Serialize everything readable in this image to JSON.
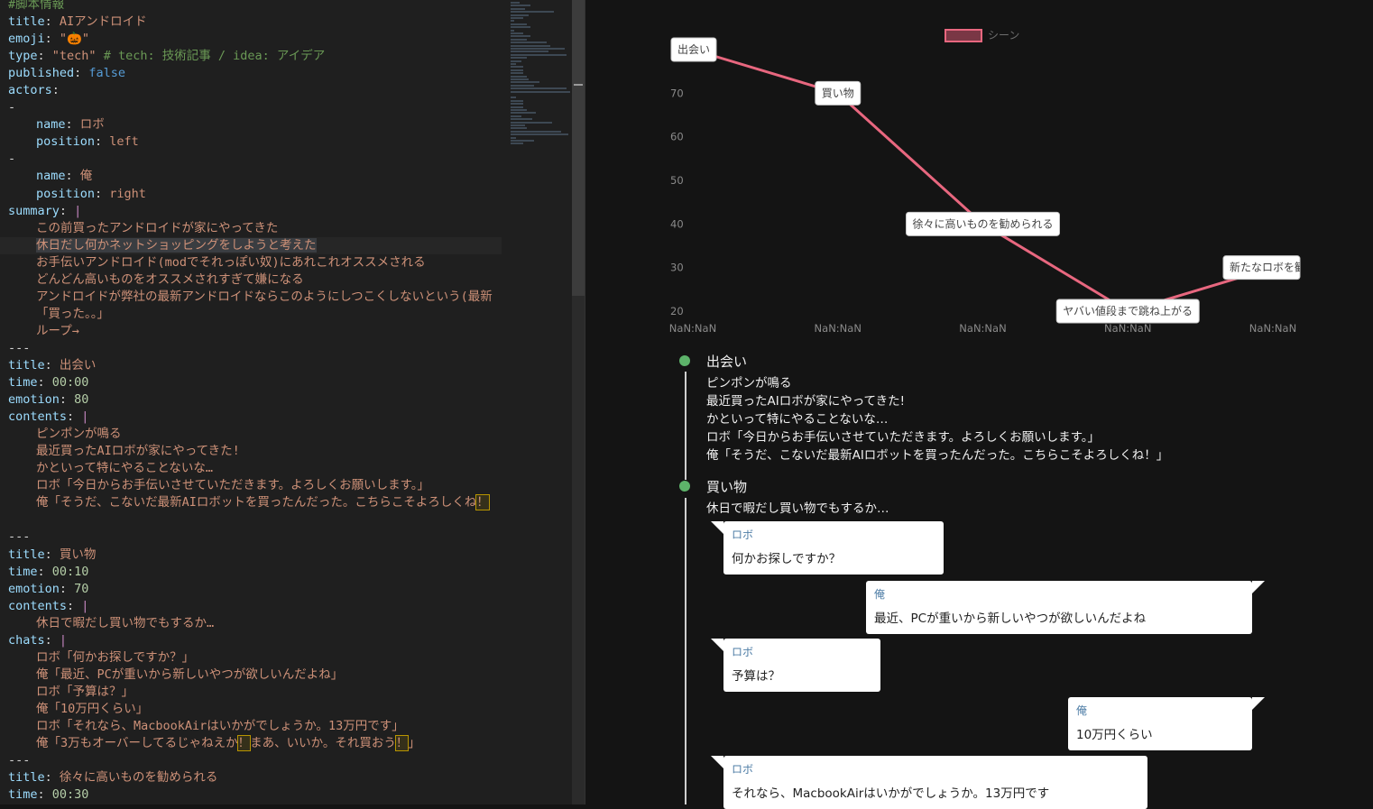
{
  "editor": {
    "lines": [
      {
        "t": "comment",
        "text": "#脚本情報"
      },
      {
        "t": "kv",
        "key": "title",
        "val": "AIアンドロイド",
        "vt": "s"
      },
      {
        "t": "kv",
        "key": "emoji",
        "val": "\"🎃\"",
        "vt": "s"
      },
      {
        "t": "kvc",
        "key": "type",
        "val": "\"tech\"",
        "vt": "s",
        "comment": "# tech: 技術記事 / idea: アイデア"
      },
      {
        "t": "kv",
        "key": "published",
        "val": "false",
        "vt": "b"
      },
      {
        "t": "kv",
        "key": "actors",
        "val": "",
        "vt": "s"
      },
      {
        "t": "dash",
        "text": "-"
      },
      {
        "t": "kv",
        "ind": 1,
        "key": "name",
        "val": "ロボ",
        "vt": "s"
      },
      {
        "t": "kv",
        "ind": 1,
        "key": "position",
        "val": "left",
        "vt": "s"
      },
      {
        "t": "dash",
        "text": "-"
      },
      {
        "t": "kv",
        "ind": 1,
        "key": "name",
        "val": "俺",
        "vt": "s"
      },
      {
        "t": "kv",
        "ind": 1,
        "key": "position",
        "val": "right",
        "vt": "s"
      },
      {
        "t": "kv",
        "key": "summary",
        "val": "|",
        "vt": "pipe"
      },
      {
        "t": "text",
        "ind": 1,
        "text": "この前買ったアンドロイドが家にやってきた"
      },
      {
        "t": "text",
        "ind": 1,
        "text": "休日だし何かネットショッピングをしようと考えた",
        "hl": true
      },
      {
        "t": "text",
        "ind": 1,
        "text": "お手伝いアンドロイド(modでそれっぽい奴)にあれこれオススメされる"
      },
      {
        "t": "text",
        "ind": 1,
        "text": "どんどん高いものをオススメされすぎて嫌になる"
      },
      {
        "t": "text",
        "ind": 1,
        "text": "アンドロイドが弊社の最新アンドロイドならこのようにしつこくしないという(最新"
      },
      {
        "t": "text",
        "ind": 1,
        "text": "「買った。。」"
      },
      {
        "t": "text",
        "ind": 1,
        "text": "ループ→"
      },
      {
        "t": "dash",
        "text": "---"
      },
      {
        "t": "kv",
        "key": "title",
        "val": "出会い",
        "vt": "s"
      },
      {
        "t": "kv",
        "key": "time",
        "val": "00:00",
        "vt": "n"
      },
      {
        "t": "kv",
        "key": "emotion",
        "val": "80",
        "vt": "n"
      },
      {
        "t": "kv",
        "key": "contents",
        "val": "|",
        "vt": "pipe"
      },
      {
        "t": "text",
        "ind": 1,
        "text": "ピンポンが鳴る"
      },
      {
        "t": "text",
        "ind": 1,
        "text": "最近買ったAIロボが家にやってきた!"
      },
      {
        "t": "text",
        "ind": 1,
        "text": "かといって特にやることないな…"
      },
      {
        "t": "text",
        "ind": 1,
        "text": "ロボ「今日からお手伝いさせていただきます。よろしくお願いします。」"
      },
      {
        "t": "textw",
        "ind": 1,
        "text": "俺「そうだ、こないだ最新AIロボットを買ったんだった。こちらこそよろしくね",
        "w": "！"
      },
      {
        "t": "blank",
        "text": ""
      },
      {
        "t": "dash",
        "text": "---"
      },
      {
        "t": "kv",
        "key": "title",
        "val": "買い物",
        "vt": "s"
      },
      {
        "t": "kv",
        "key": "time",
        "val": "00:10",
        "vt": "n"
      },
      {
        "t": "kv",
        "key": "emotion",
        "val": "70",
        "vt": "n"
      },
      {
        "t": "kv",
        "key": "contents",
        "val": "|",
        "vt": "pipe"
      },
      {
        "t": "text",
        "ind": 1,
        "text": "休日で暇だし買い物でもするか…"
      },
      {
        "t": "kv",
        "key": "chats",
        "val": "|",
        "vt": "pipe"
      },
      {
        "t": "text",
        "ind": 1,
        "text": "ロボ「何かお探しですか？」"
      },
      {
        "t": "text",
        "ind": 1,
        "text": "俺「最近、PCが重いから新しいやつが欲しいんだよね」"
      },
      {
        "t": "text",
        "ind": 1,
        "text": "ロボ「予算は？」"
      },
      {
        "t": "text",
        "ind": 1,
        "text": "俺「10万円くらい」"
      },
      {
        "t": "text",
        "ind": 1,
        "text": "ロボ「それなら、MacbookAirはいかがでしょうか。13万円です」"
      },
      {
        "t": "textw2",
        "ind": 1,
        "text": "俺「3万もオーバーしてるじゃねえか",
        "w": "！",
        "mid": "まあ、いいか。それ買おう",
        "w2": "！",
        "end": "」"
      },
      {
        "t": "dash",
        "text": "---"
      },
      {
        "t": "kv",
        "key": "title",
        "val": "徐々に高いものを勧められる",
        "vt": "s"
      },
      {
        "t": "kv",
        "key": "time",
        "val": "00:30",
        "vt": "n"
      }
    ]
  },
  "chart_data": {
    "type": "line",
    "legend": "シーン",
    "x": [
      "NaN:NaN",
      "NaN:NaN",
      "NaN:NaN",
      "NaN:NaN",
      "NaN:NaN"
    ],
    "yticks": [
      20,
      30,
      40,
      50,
      60,
      70
    ],
    "ylim": [
      20,
      80
    ],
    "color": "#e8677f",
    "points": [
      {
        "label": "出会い",
        "value": 80
      },
      {
        "label": "買い物",
        "value": 70
      },
      {
        "label": "徐々に高いものを勧められる",
        "value": 40
      },
      {
        "label": "ヤバい値段まで跳ね上がる",
        "value": 20
      },
      {
        "label": "新たなロボを勧め",
        "value": 30
      }
    ]
  },
  "timeline": {
    "scenes": [
      {
        "title": "出会い",
        "contents": "ピンポンが鳴る\n最近買ったAIロボが家にやってきた!\nかといって特にやることないな…\nロボ「今日からお手伝いさせていただきます。よろしくお願いします。」\n俺「そうだ、こないだ最新AIロボットを買ったんだった。こちらこそよろしくね！」"
      },
      {
        "title": "買い物",
        "contents": "休日で暇だし買い物でもするか…"
      }
    ],
    "chats": [
      {
        "who": "ロボ",
        "msg": "何かお探しですか？",
        "side": "left"
      },
      {
        "who": "俺",
        "msg": "最近、PCが重いから新しいやつが欲しいんだよね",
        "side": "right"
      },
      {
        "who": "ロボ",
        "msg": "予算は？",
        "side": "left"
      },
      {
        "who": "俺",
        "msg": "10万円くらい",
        "side": "right"
      },
      {
        "who": "ロボ",
        "msg": "それなら、MacbookAirはいかがでしょうか。13万円です",
        "side": "left"
      }
    ]
  }
}
